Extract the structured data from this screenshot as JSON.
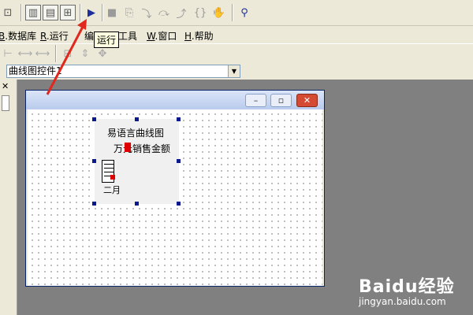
{
  "tooltip": {
    "text": "运行"
  },
  "menu": {
    "items": [
      {
        "key": "B",
        "label": "数据库"
      },
      {
        "key": "R",
        "label": "运行"
      },
      {
        "key": "",
        "label": "编"
      },
      {
        "key": "",
        "label": "工具"
      },
      {
        "key": "W",
        "label": "窗口"
      },
      {
        "key": "H",
        "label": "帮助"
      }
    ]
  },
  "combo": {
    "value": "曲线图控件1"
  },
  "form": {
    "title": "",
    "buttons": [
      "minimize",
      "maximize",
      "close"
    ]
  },
  "chart_data": {
    "type": "bar",
    "title": "易语言曲线图",
    "ylabel": "万元",
    "legend": "销售金额",
    "categories": [
      "二月"
    ],
    "values": [],
    "grid": true
  },
  "icons": {
    "run": "play-icon",
    "stop": "stop-icon"
  },
  "watermark": {
    "text": "Baidu经验",
    "url": "jingyan.baidu.com"
  }
}
